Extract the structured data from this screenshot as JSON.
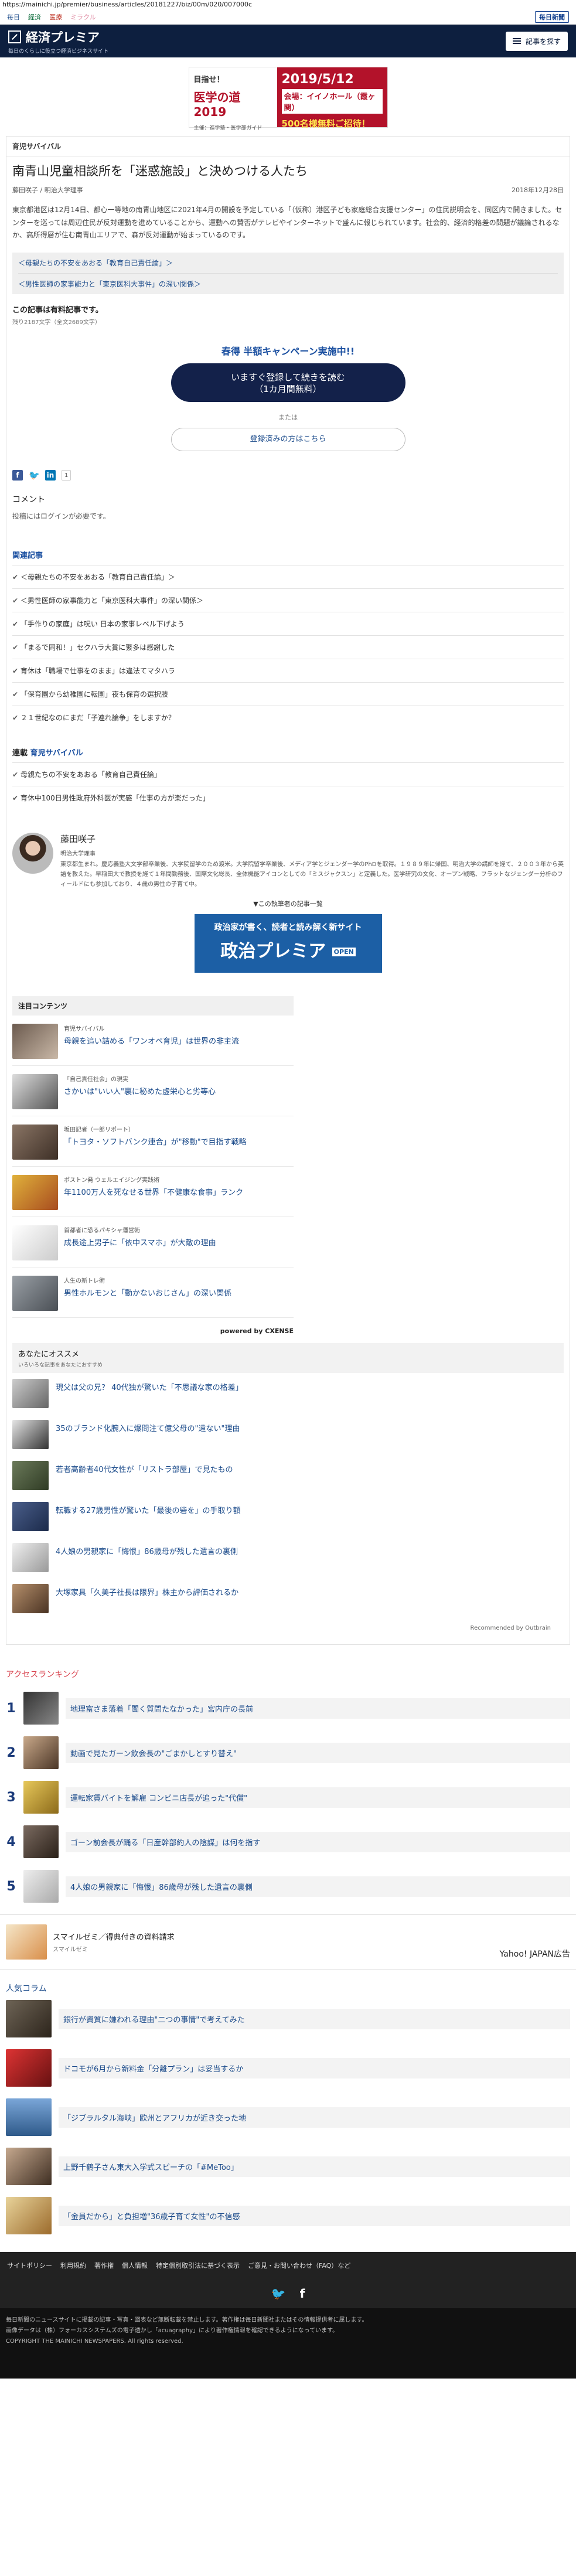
{
  "url": "https://mainichi.jp/premier/business/articles/20181227/biz/00m/020/007000c",
  "topnav": {
    "items": [
      "毎日",
      "経済",
      "医療",
      "ミラクル"
    ],
    "logo": "毎日新聞"
  },
  "header": {
    "brand": "経済プレミア",
    "tagline": "毎日のくらしに役立つ経済ビジネスサイト",
    "menu": "記事を探す"
  },
  "ad_top": {
    "a": "目指せ！",
    "b": "医学の道 2019",
    "c": "主催：進学塾・医学部ガイド",
    "d": "2019/5/12",
    "e": "会場：イイノホール（霞ヶ関）",
    "f": "500名様無料ご招待！"
  },
  "article": {
    "category": "育児サバイバル",
    "title": "南青山児童相談所を「迷惑施設」と決めつける人たち",
    "author": "藤田咲子 / 明治大学理事",
    "date": "2018年12月28日",
    "lead": "東京都港区は12月14日、都心一等地の南青山地区に2021年4月の開設を予定している「（仮称）港区子ども家庭総合支援センター」の住民説明会を、同区内で開きました。センターを巡っては周辺住民が反対運動を進めていることから、運動への賛否がテレビやインターネットで盛んに報じられています。社会的、経済的格差の問題が議論されるなか、高所得層が住む南青山エリアで、森が反対運動が始まっているのです。",
    "related": [
      "＜母親たちの不安をあおる「教育自己責任論」＞",
      "＜男性医師の家事能力と「東京医科大事件」の深い関係＞"
    ],
    "paid1": "この記事は有料記事です。",
    "paid2": "残り2187文字（全文2689文字）",
    "campaign": "春得 半額キャンペーン実施中!!",
    "btn_main_1": "いますぐ登録して続きを読む",
    "btn_main_2": "（1カ月間無料）",
    "or": "または",
    "btn_sub": "登録済みの方はこちら",
    "share_count": "1",
    "comment_h": "コメント",
    "comment_t": "投稿にはログインが必要です。"
  },
  "related_list": {
    "heading": "関連記事",
    "items": [
      "＜母親たちの不安をあおる「教育自己責任論」＞",
      "＜男性医師の家事能力と「東京医科大事件」の深い関係＞",
      "「手作りの家庭」は呪い 日本の家事レベル下げよう",
      "「まるで同和！」セクハラ大賞に繁多は感謝した",
      "育休は「職場で仕事をのまま」は違法てマタハラ",
      "「保育園から幼稚園に転園」夜も保育の選択肢",
      "２１世紀なのにまだ「子連れ論争」をしますか？"
    ]
  },
  "series_list": {
    "heading_a": "連載",
    "heading_b": "育児サバイバル",
    "items": [
      "母親たちの不安をあおる「教育自己責任論」",
      "育休中100日男性政府外科医が実感「仕事の方が楽だった」"
    ]
  },
  "author_box": {
    "name": "藤田咲子",
    "role": "明治大学理事",
    "bio": "東京都生まれ。慶応義塾大文学部卒業後、大学院留学のため渡米。大学院留学卒業後、メディア学とジェンダー学のPhDを取得。１９８９年に帰国、明治大学の講師を経て、２００３年から英語を教えた。早稲田大で教授を経て１年間勤務後、国際文化総長、全体機能アイコンとしての「ミスジャクスン」と定義した。医学研究の文化、オープン戦略、フラットなジェンダー分析のフィールドにも参加しており、４歳の男性の子育て中。",
    "more": "▼この執筆者の記事一覧"
  },
  "banner": {
    "b1": "政治家が書く、読者と読み解く新サイト",
    "b2": "政治プレミア",
    "op": "OPEN"
  },
  "pickup": {
    "heading": "注目コンテンツ",
    "items": [
      {
        "k": "育児サバイバル",
        "h": "母親を追い詰める「ワンオペ育児」は世界の非主流"
      },
      {
        "k": "「自己責任社会」の現実",
        "h": "さかいは\"いい人\"裏に秘めた虚栄心と劣等心"
      },
      {
        "k": "坂田記者（一郎リポート）",
        "h": "「トヨタ・ソフトバンク連合」が\"移動\"で目指す戦略"
      },
      {
        "k": "ポストン発 ウェルエイジング実践術",
        "h": "年1100万人を死なせる世界「不健康な食事」ランク"
      },
      {
        "k": "首都者に恐るパキシャ運営術",
        "h": "成長途上男子に「依中スマホ」が大敵の理由"
      },
      {
        "k": "人生の新トレ術",
        "h": "男性ホルモンと「動かないおじさん」の深い関係"
      }
    ],
    "powered": "powered by CXENSE"
  },
  "reco": {
    "heading": "あなたにオススメ",
    "sub": "いろいろな記事をあなたにおすすめ",
    "items": [
      "現父は父の兄？ 40代独が驚いた「不思議な家の格差」",
      "35のブランド化腕入に爆問注て億父母の\"遠ない\"理由",
      "若者高齢者40代女性が「リストラ部屋」で見たもの",
      "転職する27歳男性が驚いた「最後の砦を」の手取り額",
      "4人娘の男親家に「悔恨」86歳母が残した遺言の裏側",
      "大塚家具「久美子社長は限界」株主から評価されるか"
    ],
    "outbrain": "Recommended by Outbrain"
  },
  "ranking": {
    "heading": "アクセスランキング",
    "items": [
      {
        "no": "1",
        "h": "地理富さま落着「聞く質問たなかった」宮内庁の長前"
      },
      {
        "no": "2",
        "h": "動画で見たガーン飲会長の\"ごまかしとすり替え\""
      },
      {
        "no": "3",
        "h": "運転家賃バイトを解雇 コンビニ店長が追った\"代償\""
      },
      {
        "no": "4",
        "h": "ゴーン前会長が踊る「日産幹部約人の陰謀」は何を指す"
      },
      {
        "no": "5",
        "h": "4人娘の男親家に「悔恨」86歳母が残した遺言の裏側"
      }
    ]
  },
  "smile": {
    "h": "スマイルゼミ／得典付きの資料請求",
    "s": "スマイルゼミ",
    "yj": "Yahoo! JAPAN広告"
  },
  "column": {
    "heading": "人気コラム",
    "items": [
      "銀行が資質に嫌われる理由\"二つの事情\"で考えてみた",
      "ドコモが6月から新料金「分離プラン」は妥当するか",
      "「ジブラルタル海峡」欧州とアフリカが近き交った地",
      "上野千鶴子さん東大入学式スピーチの「#MeToo」",
      "「金員だから」と負担増\"36歳子育て女性\"の不信感"
    ]
  },
  "footer": {
    "nav": [
      "サイトポリシー",
      "利用規約",
      "著作権",
      "個人情報",
      "特定個別取引法に基づく表示",
      "ご意見・お問い合わせ（FAQ）など"
    ],
    "copy1": "毎日新聞のニュースサイトに掲載の記事・写真・図表など無断転載を禁止します。著作権は毎日新聞社またはその情報提供者に属します。",
    "copy2": "画像データは（株）フォーカスシステムズの電子透かし「acuagraphy」により著作権情報を確認できるようになっています。",
    "copy3": "COPYRIGHT THE MAINICHI NEWSPAPERS. All rights reserved."
  }
}
